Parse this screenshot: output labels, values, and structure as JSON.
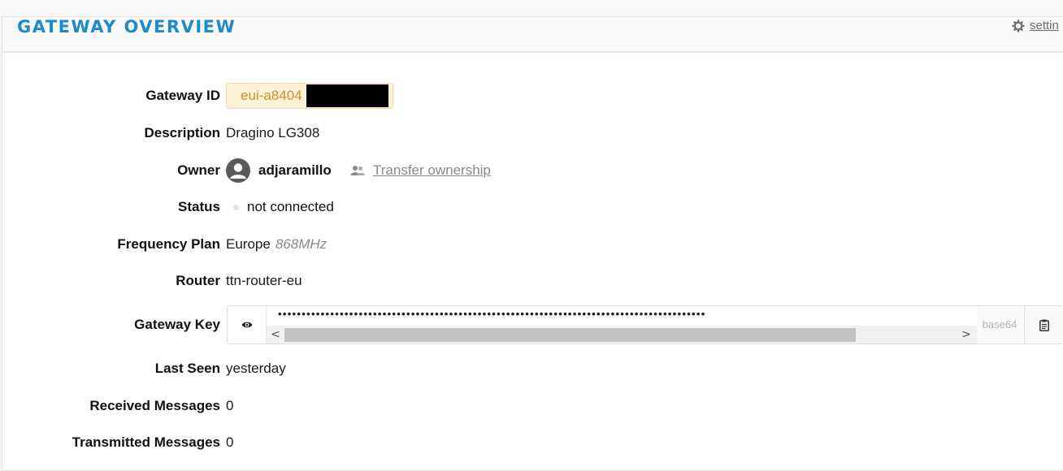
{
  "header": {
    "title": "GATEWAY OVERVIEW",
    "settings_label": "settin",
    "settings_icon": "gear-icon"
  },
  "fields": {
    "gateway_id": {
      "label": "Gateway ID",
      "value": "eui-a8404"
    },
    "description": {
      "label": "Description",
      "value": "Dragino LG308"
    },
    "owner": {
      "label": "Owner",
      "username": "adjaramillo",
      "transfer_label": "Transfer ownership",
      "avatar_icon": "user-avatar-icon",
      "transfer_icon": "users-icon"
    },
    "status": {
      "label": "Status",
      "value": "not connected",
      "dot_color": "#e4e4e4"
    },
    "frequency_plan": {
      "label": "Frequency Plan",
      "value": "Europe",
      "sub": "868MHz"
    },
    "router": {
      "label": "Router",
      "value": "ttn-router-eu"
    },
    "gateway_key": {
      "label": "Gateway Key",
      "masked_value": "••••••••••••••••••••••••••••••••••••••••••••••••••••••••••••••••••••••••••••••••••••••••••",
      "encoding": "base64",
      "reveal_icon": "eye-icon",
      "copy_icon": "clipboard-icon",
      "scroll_left": "<",
      "scroll_right": ">"
    },
    "last_seen": {
      "label": "Last Seen",
      "value": "yesterday"
    },
    "received_messages": {
      "label": "Received Messages",
      "value": "0"
    },
    "transmitted_messages": {
      "label": "Transmitted Messages",
      "value": "0"
    }
  },
  "colors": {
    "accent": "#1d8ac9",
    "id_text": "#c8912c",
    "id_background": "#fdf2d6"
  }
}
